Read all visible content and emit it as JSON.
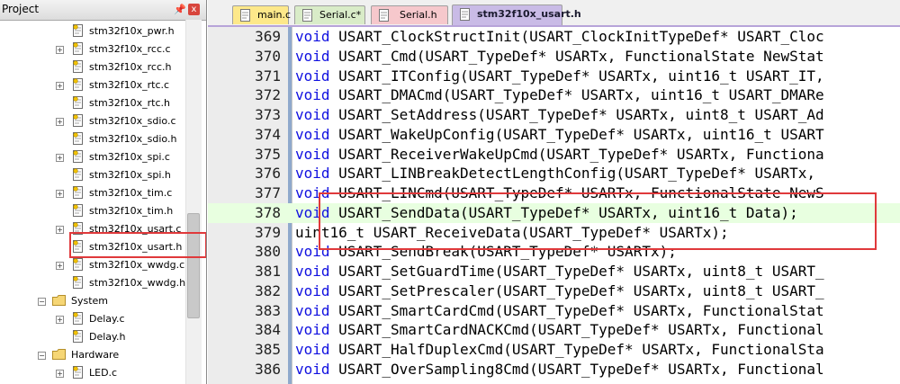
{
  "panel": {
    "title": "Project",
    "pin_icon": "pin-icon",
    "close_icon": "close-icon",
    "close_label": "x"
  },
  "tree": {
    "files_lib": [
      "stm32f10x_pwr.h",
      "stm32f10x_rcc.c",
      "stm32f10x_rcc.h",
      "stm32f10x_rtc.c",
      "stm32f10x_rtc.h",
      "stm32f10x_sdio.c",
      "stm32f10x_sdio.h",
      "stm32f10x_spi.c",
      "stm32f10x_spi.h",
      "stm32f10x_tim.c",
      "stm32f10x_tim.h",
      "stm32f10x_usart.c",
      "stm32f10x_usart.h",
      "stm32f10x_wwdg.c",
      "stm32f10x_wwdg.h"
    ],
    "group_system": "System",
    "files_system": [
      "Delay.c",
      "Delay.h"
    ],
    "group_hardware": "Hardware",
    "files_hardware": [
      "LED.c"
    ],
    "selected_file": "stm32f10x_usart.h"
  },
  "tabs": [
    "main.c",
    "Serial.c*",
    "Serial.h",
    "stm32f10x_usart.h"
  ],
  "active_tab": "stm32f10x_usart.h",
  "code": {
    "keyword_color": "#1010e0",
    "current_line": "378",
    "lines": [
      {
        "num": "369",
        "text": "USART_ClockStructInit(USART_ClockInitTypeDef* USART_Cloc"
      },
      {
        "num": "370",
        "text": "USART_Cmd(USART_TypeDef* USARTx, FunctionalState NewStat"
      },
      {
        "num": "371",
        "text": "USART_ITConfig(USART_TypeDef* USARTx, uint16_t USART_IT,"
      },
      {
        "num": "372",
        "text": "USART_DMACmd(USART_TypeDef* USARTx, uint16_t USART_DMARe"
      },
      {
        "num": "373",
        "text": "USART_SetAddress(USART_TypeDef* USARTx, uint8_t USART_Ad"
      },
      {
        "num": "374",
        "text": "USART_WakeUpConfig(USART_TypeDef* USARTx, uint16_t USART"
      },
      {
        "num": "375",
        "text": "USART_ReceiverWakeUpCmd(USART_TypeDef* USARTx, Functiona"
      },
      {
        "num": "376",
        "text": "USART_LINBreakDetectLengthConfig(USART_TypeDef* USARTx,"
      },
      {
        "num": "377",
        "text": "USART_LINCmd(USART_TypeDef* USARTx, FunctionalState NewS"
      },
      {
        "num": "378",
        "text": "USART_SendData(USART_TypeDef* USARTx, uint16_t Data);"
      },
      {
        "num": "379",
        "prefix": "",
        "text": "uint16_t USART_ReceiveData(USART_TypeDef* USARTx);"
      },
      {
        "num": "380",
        "text": "USART_SendBreak(USART_TypeDef* USARTx);"
      },
      {
        "num": "381",
        "text": "USART_SetGuardTime(USART_TypeDef* USARTx, uint8_t USART_"
      },
      {
        "num": "382",
        "text": "USART_SetPrescaler(USART_TypeDef* USARTx, uint8_t USART_"
      },
      {
        "num": "383",
        "text": "USART_SmartCardCmd(USART_TypeDef* USARTx, FunctionalStat"
      },
      {
        "num": "384",
        "text": "USART_SmartCardNACKCmd(USART_TypeDef* USARTx, Functional"
      },
      {
        "num": "385",
        "text": "USART_HalfDuplexCmd(USART_TypeDef* USARTx, FunctionalSta"
      },
      {
        "num": "386",
        "text": "USART_OverSampling8Cmd(USART_TypeDef* USARTx, Functional"
      }
    ],
    "keyword": "void"
  }
}
